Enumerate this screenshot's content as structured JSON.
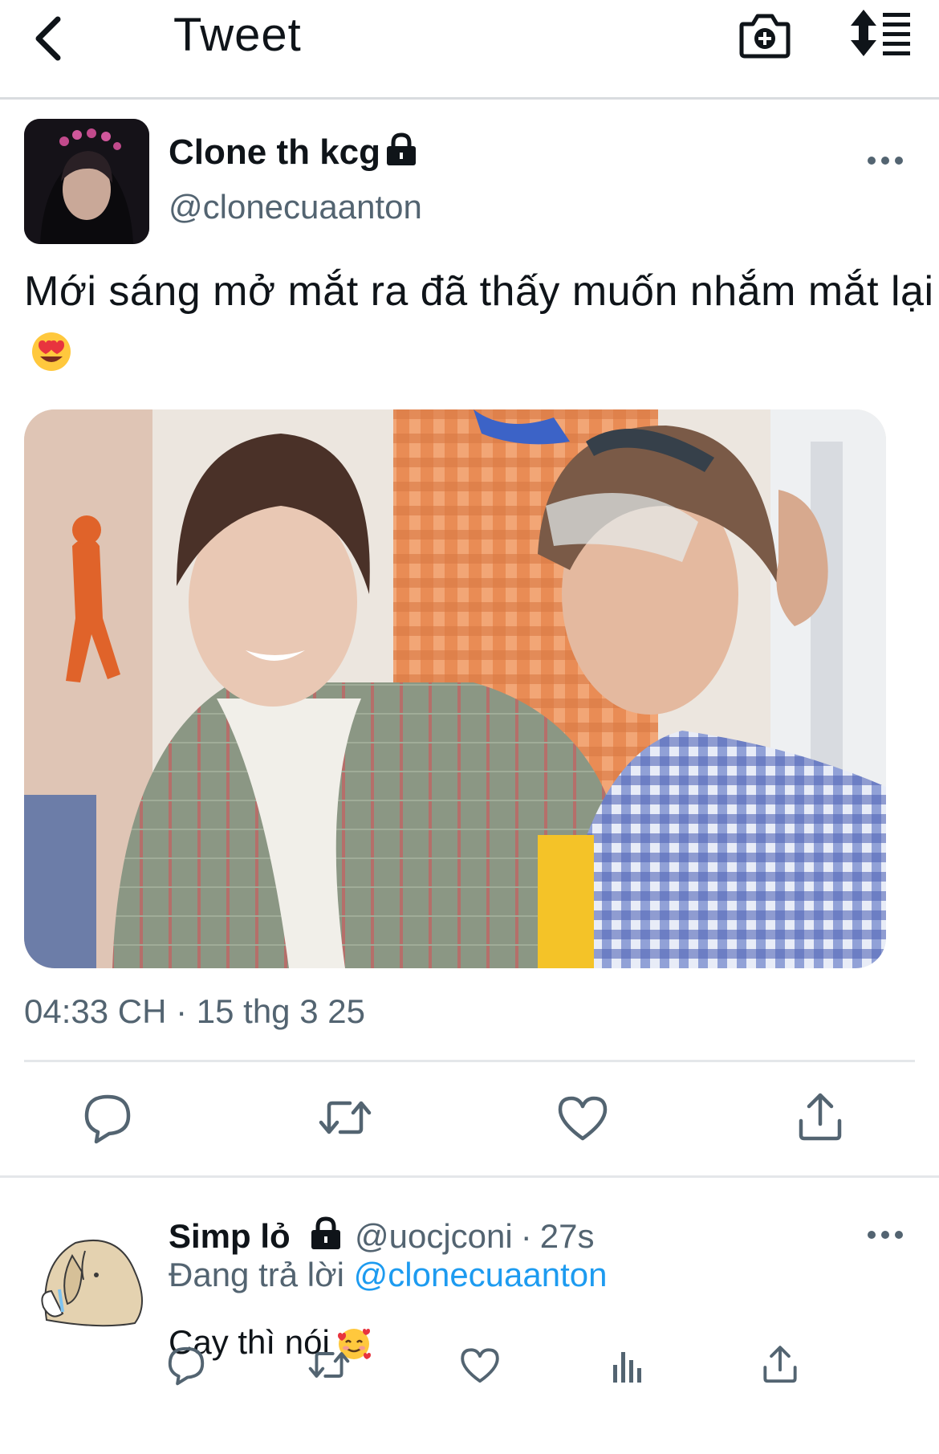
{
  "header": {
    "title": "Tweet",
    "icons": [
      "back-arrow-icon",
      "camera-add-icon",
      "sort-lines-icon"
    ]
  },
  "tweet": {
    "display_name": "Clone th kcg",
    "handle": "@clonecuaanton",
    "protected": true,
    "text": "Mới sáng mở mắt ra đã thấy muốn nhắm mắt lại",
    "emoji": "heart-eyes-emoji",
    "timestamp": "04:33 CH · 15 thg 3 25",
    "actions": [
      "reply-icon",
      "retweet-icon",
      "like-icon",
      "share-icon"
    ]
  },
  "reply": {
    "display_name": "Simp lỏ",
    "handle": "@uocjconi",
    "separator": "·",
    "time": "27s",
    "replying_prefix": "Đang trả lời",
    "replying_to": "@clonecuaanton",
    "text": "Cay thì nói",
    "emoji": "smiling-face-with-hearts-emoji",
    "actions": [
      "reply-icon",
      "retweet-icon",
      "like-icon",
      "analytics-icon",
      "share-icon"
    ]
  },
  "colors": {
    "text": "#0f1419",
    "secondary": "#536471",
    "link": "#1d9bf0",
    "divider": "#e4e7ea"
  }
}
